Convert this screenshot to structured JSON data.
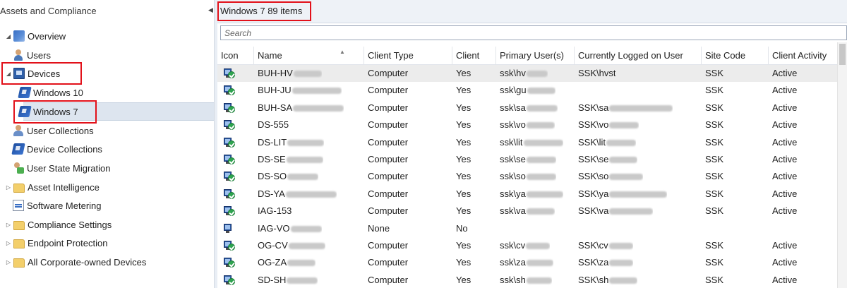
{
  "nav": {
    "title": "Assets and Compliance",
    "items": [
      {
        "label": "Overview",
        "icon": "overview-icon",
        "expander": "◢"
      },
      {
        "label": "Users",
        "icon": "users-icon",
        "expander": ""
      },
      {
        "label": "Devices",
        "icon": "devices-icon",
        "expander": "◢"
      },
      {
        "label": "Windows 10",
        "icon": "device-collection-icon",
        "expander": ""
      },
      {
        "label": "Windows 7",
        "icon": "device-collection-icon",
        "expander": ""
      },
      {
        "label": "User Collections",
        "icon": "user-collections-icon",
        "expander": ""
      },
      {
        "label": "Device Collections",
        "icon": "device-collections-icon",
        "expander": ""
      },
      {
        "label": "User State Migration",
        "icon": "user-state-migration-icon",
        "expander": ""
      },
      {
        "label": "Asset Intelligence",
        "icon": "folder-icon",
        "expander": "▷"
      },
      {
        "label": "Software Metering",
        "icon": "software-metering-icon",
        "expander": ""
      },
      {
        "label": "Compliance Settings",
        "icon": "folder-icon",
        "expander": "▷"
      },
      {
        "label": "Endpoint Protection",
        "icon": "folder-icon",
        "expander": "▷"
      },
      {
        "label": "All Corporate-owned Devices",
        "icon": "folder-icon",
        "expander": "▷"
      }
    ]
  },
  "results": {
    "title": "Windows 7 89 items",
    "search_placeholder": "Search",
    "columns": [
      "Icon",
      "Name",
      "Client Type",
      "Client",
      "Primary User(s)",
      "Currently Logged on User",
      "Site Code",
      "Client Activity"
    ],
    "rows": [
      {
        "name": "BUH-HV",
        "client_type": "Computer",
        "client": "Yes",
        "primary_user": "ssk\\hv",
        "logged_on": "SSK\\hvst",
        "site": "SSK",
        "activity": "Active",
        "managed": true
      },
      {
        "name": "BUH-JU",
        "client_type": "Computer",
        "client": "Yes",
        "primary_user": "ssk\\gu",
        "logged_on": "",
        "site": "SSK",
        "activity": "Active",
        "managed": true
      },
      {
        "name": "BUH-SA",
        "client_type": "Computer",
        "client": "Yes",
        "primary_user": "ssk\\sa",
        "logged_on": "SSK\\sa",
        "site": "SSK",
        "activity": "Active",
        "managed": true
      },
      {
        "name": "DS-555",
        "client_type": "Computer",
        "client": "Yes",
        "primary_user": "ssk\\vo",
        "logged_on": "SSK\\vo",
        "site": "SSK",
        "activity": "Active",
        "managed": true
      },
      {
        "name": "DS-LIT",
        "client_type": "Computer",
        "client": "Yes",
        "primary_user": "ssk\\lit",
        "logged_on": "SSK\\lit",
        "site": "SSK",
        "activity": "Active",
        "managed": true
      },
      {
        "name": "DS-SE",
        "client_type": "Computer",
        "client": "Yes",
        "primary_user": "ssk\\se",
        "logged_on": "SSK\\se",
        "site": "SSK",
        "activity": "Active",
        "managed": true
      },
      {
        "name": "DS-SO",
        "client_type": "Computer",
        "client": "Yes",
        "primary_user": "ssk\\so",
        "logged_on": "SSK\\so",
        "site": "SSK",
        "activity": "Active",
        "managed": true
      },
      {
        "name": "DS-YA",
        "client_type": "Computer",
        "client": "Yes",
        "primary_user": "ssk\\ya",
        "logged_on": "SSK\\ya",
        "site": "SSK",
        "activity": "Active",
        "managed": true
      },
      {
        "name": "IAG-153",
        "client_type": "Computer",
        "client": "Yes",
        "primary_user": "ssk\\va",
        "logged_on": "SSK\\va",
        "site": "SSK",
        "activity": "Active",
        "managed": true
      },
      {
        "name": "IAG-VO",
        "client_type": "None",
        "client": "No",
        "primary_user": "",
        "logged_on": "",
        "site": "",
        "activity": "",
        "managed": false
      },
      {
        "name": "OG-CV",
        "client_type": "Computer",
        "client": "Yes",
        "primary_user": "ssk\\cv",
        "logged_on": "SSK\\cv",
        "site": "SSK",
        "activity": "Active",
        "managed": true
      },
      {
        "name": "OG-ZA",
        "client_type": "Computer",
        "client": "Yes",
        "primary_user": "ssk\\za",
        "logged_on": "SSK\\za",
        "site": "SSK",
        "activity": "Active",
        "managed": true
      },
      {
        "name": "SD-SH",
        "client_type": "Computer",
        "client": "Yes",
        "primary_user": "ssk\\sh",
        "logged_on": "SSK\\sh",
        "site": "SSK",
        "activity": "Active",
        "managed": true
      }
    ]
  },
  "colors": {
    "highlight": "#e2111a",
    "selected_row": "#ececec",
    "check": "#2ea44f"
  }
}
